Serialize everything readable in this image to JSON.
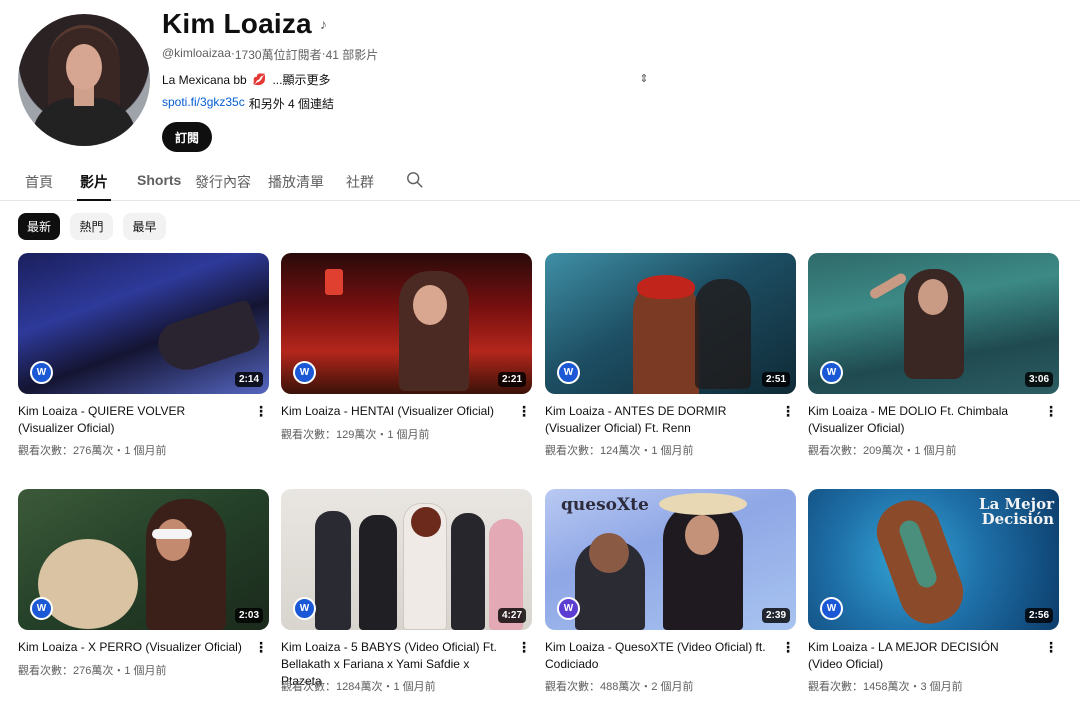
{
  "channel": {
    "name": "Kim Loaiza",
    "handle": "@kimloaizaa",
    "separator": " · ",
    "subscribers": "1730萬位訂閱者",
    "video_count": "41 部影片",
    "description": "La Mexicana bb",
    "show_more": "...顯示更多",
    "link": "spoti.fi/3gkz35c",
    "more_links": "和另外 4 個連結",
    "subscribe_label": "訂閱"
  },
  "tabs": [
    "首頁",
    "影片",
    "Shorts",
    "發行內容",
    "播放清單",
    "社群"
  ],
  "filters": [
    "最新",
    "熱門",
    "最早"
  ],
  "videos": [
    {
      "title": "Kim Loaiza - QUIERE VOLVER (Visualizer Oficial)",
      "stats": "觀看次數：276萬次・1 個月前",
      "duration": "2:14"
    },
    {
      "title": "Kim Loaiza - HENTAI (Visualizer Oficial)",
      "stats": "觀看次數：129萬次・1 個月前",
      "duration": "2:21"
    },
    {
      "title": "Kim Loaiza - ANTES DE DORMIR (Visualizer Oficial) Ft. Renn",
      "stats": "觀看次數：124萬次・1 個月前",
      "duration": "2:51"
    },
    {
      "title": "Kim Loaiza - ME DOLIO Ft. Chimbala (Visualizer Oficial)",
      "stats": "觀看次數：209萬次・1 個月前",
      "duration": "3:06"
    },
    {
      "title": "Kim Loaiza - X PERRO (Visualizer Oficial)",
      "stats": "觀看次數：276萬次・1 個月前",
      "duration": "2:03"
    },
    {
      "title": "Kim Loaiza - 5 BABYS (Video Oficial) Ft. Bellakath x Fariana x Yami Safdie x Ptazeta",
      "stats": "觀看次數：1284萬次・1 個月前",
      "duration": "4:27"
    },
    {
      "title": "Kim Loaiza - QuesoXTE (Video Oficial) ft. Codiciado",
      "stats": "觀看次數：488萬次・2 個月前",
      "duration": "2:39"
    },
    {
      "title": "Kim Loaiza - LA MEJOR DECISIÓN (Video Oficial)",
      "stats": "觀看次數：1458萬次・3 個月前",
      "duration": "2:56"
    }
  ],
  "thumb_text": {
    "queso": "quesoXte",
    "mejor": "La Mejor Decisión"
  },
  "colors": {
    "link": "#065fd4",
    "accent_dark": "#0f0f0f",
    "muted": "#606060",
    "warner_badge": "#1a58d6"
  }
}
